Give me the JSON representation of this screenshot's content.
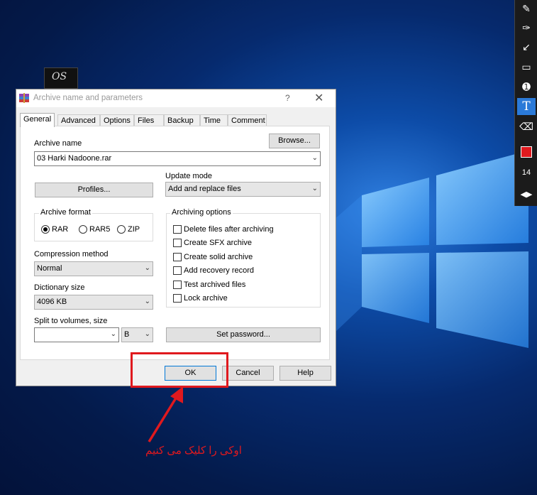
{
  "desktop": {
    "icon_label": "OS",
    "annotation_text": "اوکی را کلیک می کنیم",
    "annotation_color": "#e0191e"
  },
  "dialog": {
    "title": "Archive name and parameters",
    "help_glyph": "?",
    "close_glyph": "✕",
    "tabs": [
      "General",
      "Advanced",
      "Options",
      "Files",
      "Backup",
      "Time",
      "Comment"
    ],
    "active_tab": "General",
    "archive_name_label": "Archive name",
    "browse_button": "Browse...",
    "archive_name_value": "03 Harki Nadoone.rar",
    "profiles_button": "Profiles...",
    "update_mode_label": "Update mode",
    "update_mode_value": "Add and replace files",
    "archive_format_label": "Archive format",
    "formats": [
      {
        "label": "RAR",
        "selected": true
      },
      {
        "label": "RAR5",
        "selected": false
      },
      {
        "label": "ZIP",
        "selected": false
      }
    ],
    "archiving_options_label": "Archiving options",
    "archiving_options": [
      "Delete files after archiving",
      "Create SFX archive",
      "Create solid archive",
      "Add recovery record",
      "Test archived files",
      "Lock archive"
    ],
    "compression_method_label": "Compression method",
    "compression_method_value": "Normal",
    "dictionary_size_label": "Dictionary size",
    "dictionary_size_value": "4096 KB",
    "split_label": "Split to volumes, size",
    "split_value": "",
    "split_unit": "B",
    "set_password_button": "Set password...",
    "ok_button": "OK",
    "cancel_button": "Cancel",
    "help_button": "Help"
  },
  "toolbar": {
    "tools": [
      "pencil-icon",
      "highlighter-icon",
      "arrow-icon",
      "rectangle-icon",
      "numbering-icon",
      "text-icon",
      "eraser-icon",
      "color-swatch",
      "size-value",
      "expand-icon"
    ],
    "size_value": "14",
    "active_color": "#e0191e",
    "active_tool": "text-icon"
  }
}
